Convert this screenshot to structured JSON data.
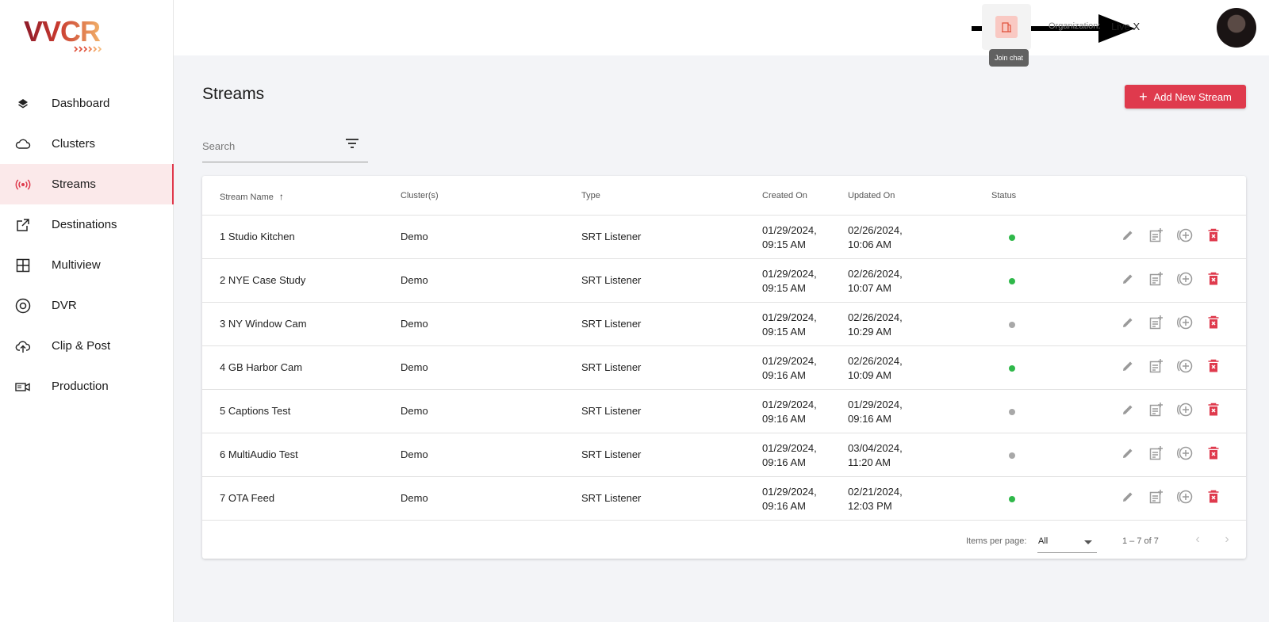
{
  "brand": {
    "logo_text": "VVCR",
    "accent": "#df3a4d"
  },
  "sidebar": {
    "items": [
      {
        "label": "Dashboard",
        "icon": "layers-icon"
      },
      {
        "label": "Clusters",
        "icon": "cloud-icon"
      },
      {
        "label": "Streams",
        "icon": "broadcast-icon",
        "active": true
      },
      {
        "label": "Destinations",
        "icon": "external-link-icon"
      },
      {
        "label": "Multiview",
        "icon": "grid-icon"
      },
      {
        "label": "DVR",
        "icon": "disc-icon"
      },
      {
        "label": "Clip & Post",
        "icon": "cloud-upload-icon"
      },
      {
        "label": "Production",
        "icon": "video-camera-icon"
      }
    ]
  },
  "header": {
    "tooltip": "Join chat",
    "org_label": "Organization:",
    "org_value": "Live X"
  },
  "main": {
    "title": "Streams",
    "add_button": "Add New Stream",
    "search_placeholder": "Search"
  },
  "table": {
    "columns": [
      "Stream Name",
      "Cluster(s)",
      "Type",
      "Created On",
      "Updated On",
      "Status"
    ],
    "sort_column": "Stream Name",
    "rows": [
      {
        "name": "1 Studio Kitchen",
        "cluster": "Demo",
        "type": "SRT Listener",
        "created_date": "01/29/2024,",
        "created_time": "09:15 AM",
        "updated_date": "02/26/2024,",
        "updated_time": "10:06 AM",
        "status": "online"
      },
      {
        "name": "2 NYE Case Study",
        "cluster": "Demo",
        "type": "SRT Listener",
        "created_date": "01/29/2024,",
        "created_time": "09:15 AM",
        "updated_date": "02/26/2024,",
        "updated_time": "10:07 AM",
        "status": "online"
      },
      {
        "name": "3 NY Window Cam",
        "cluster": "Demo",
        "type": "SRT Listener",
        "created_date": "01/29/2024,",
        "created_time": "09:15 AM",
        "updated_date": "02/26/2024,",
        "updated_time": "10:29 AM",
        "status": "offline"
      },
      {
        "name": "4 GB Harbor Cam",
        "cluster": "Demo",
        "type": "SRT Listener",
        "created_date": "01/29/2024,",
        "created_time": "09:16 AM",
        "updated_date": "02/26/2024,",
        "updated_time": "10:09 AM",
        "status": "online"
      },
      {
        "name": "5 Captions Test",
        "cluster": "Demo",
        "type": "SRT Listener",
        "created_date": "01/29/2024,",
        "created_time": "09:16 AM",
        "updated_date": "01/29/2024,",
        "updated_time": "09:16 AM",
        "status": "offline"
      },
      {
        "name": "6 MultiAudio Test",
        "cluster": "Demo",
        "type": "SRT Listener",
        "created_date": "01/29/2024,",
        "created_time": "09:16 AM",
        "updated_date": "03/04/2024,",
        "updated_time": "11:20 AM",
        "status": "offline"
      },
      {
        "name": "7 OTA Feed",
        "cluster": "Demo",
        "type": "SRT Listener",
        "created_date": "01/29/2024,",
        "created_time": "09:16 AM",
        "updated_date": "02/21/2024,",
        "updated_time": "12:03 PM",
        "status": "online"
      }
    ],
    "status_colors": {
      "online": "#2fb84a",
      "offline": "#a8a8a8"
    }
  },
  "pagination": {
    "items_per_page_label": "Items per page:",
    "items_per_page_value": "All",
    "range_label": "1 – 7 of 7"
  }
}
